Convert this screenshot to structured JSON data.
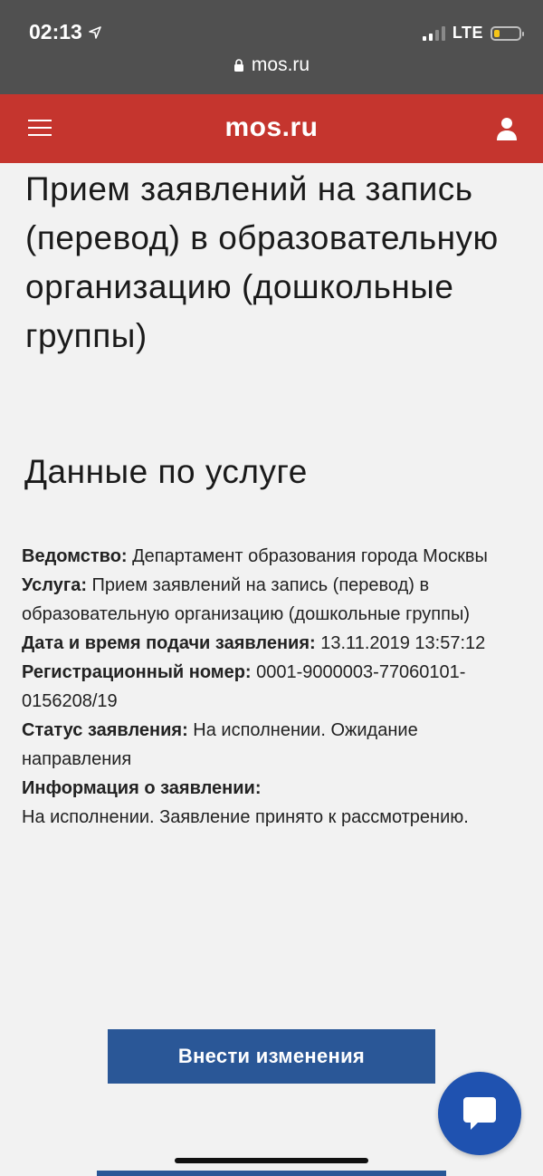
{
  "status_bar": {
    "time": "02:13",
    "network": "LTE",
    "url": "mos.ru"
  },
  "header": {
    "logo": "mos.ru",
    "brand_color": "#c5352e"
  },
  "page": {
    "title": "Прием заявлений на запись (перевод) в образовательную организацию (дошкольные группы)",
    "section_title": "Данные по услуге"
  },
  "info": [
    {
      "label": "Ведомство:",
      "value": "Департамент образования города Москвы"
    },
    {
      "label": "Услуга:",
      "value": "Прием заявлений на запись (перевод) в образовательную организацию (дошкольные группы)"
    },
    {
      "label": "Дата и время подачи заявления:",
      "value": "13.11.2019 13:57:12"
    },
    {
      "label": "Регистрационный номер:",
      "value": "0001-9000003-77060101-0156208/19"
    },
    {
      "label": "Статус заявления:",
      "value": "На исполнении. Ожидание направления"
    },
    {
      "label": "Информация о заявлении:",
      "value": "На исполнении. Заявление принято к рассмотрению."
    }
  ],
  "actions": {
    "edit_button": "Внести изменения",
    "button_color": "#2a5797",
    "chat_color": "#1f52b0"
  },
  "icons": {
    "location": "location-arrow-icon",
    "lock": "lock-icon",
    "menu": "hamburger-menu-icon",
    "user": "user-icon",
    "chat": "chat-bubble-icon"
  }
}
